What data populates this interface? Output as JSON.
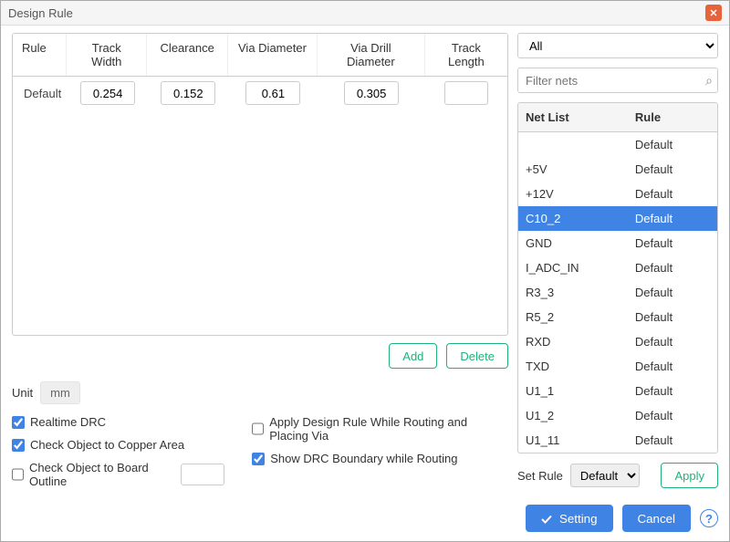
{
  "title": "Design Rule",
  "rule_columns": {
    "rule": "Rule",
    "track_width": "Track Width",
    "clearance": "Clearance",
    "via_diameter": "Via Diameter",
    "via_drill_diameter": "Via Drill Diameter",
    "track_length": "Track Length"
  },
  "rules": [
    {
      "name": "Default",
      "track_width": "0.254",
      "clearance": "0.152",
      "via_diameter": "0.61",
      "via_drill_diameter": "0.305",
      "track_length": ""
    }
  ],
  "actions": {
    "add": "Add",
    "delete": "Delete"
  },
  "unit_label": "Unit",
  "unit_value": "mm",
  "checks": {
    "realtime_drc": {
      "label": "Realtime DRC",
      "checked": true
    },
    "check_copper": {
      "label": "Check Object to Copper Area",
      "checked": true
    },
    "check_outline": {
      "label": "Check Object to Board Outline",
      "checked": false
    },
    "apply_routing": {
      "label": "Apply Design Rule While Routing and Placing Via",
      "checked": false
    },
    "show_boundary": {
      "label": "Show DRC Boundary while Routing",
      "checked": true
    }
  },
  "filter_dropdown": "All",
  "filter_placeholder": "Filter nets",
  "netlist_columns": {
    "name": "Net List",
    "rule": "Rule"
  },
  "nets": [
    {
      "name": "",
      "rule": "Default",
      "selected": false
    },
    {
      "name": "+5V",
      "rule": "Default",
      "selected": false
    },
    {
      "name": "+12V",
      "rule": "Default",
      "selected": false
    },
    {
      "name": "C10_2",
      "rule": "Default",
      "selected": true
    },
    {
      "name": "GND",
      "rule": "Default",
      "selected": false
    },
    {
      "name": "I_ADC_IN",
      "rule": "Default",
      "selected": false
    },
    {
      "name": "R3_3",
      "rule": "Default",
      "selected": false
    },
    {
      "name": "R5_2",
      "rule": "Default",
      "selected": false
    },
    {
      "name": "RXD",
      "rule": "Default",
      "selected": false
    },
    {
      "name": "TXD",
      "rule": "Default",
      "selected": false
    },
    {
      "name": "U1_1",
      "rule": "Default",
      "selected": false
    },
    {
      "name": "U1_2",
      "rule": "Default",
      "selected": false
    },
    {
      "name": "U1_11",
      "rule": "Default",
      "selected": false
    }
  ],
  "set_rule_label": "Set Rule",
  "set_rule_value": "Default",
  "apply_btn": "Apply",
  "footer": {
    "setting": "Setting",
    "cancel": "Cancel"
  }
}
